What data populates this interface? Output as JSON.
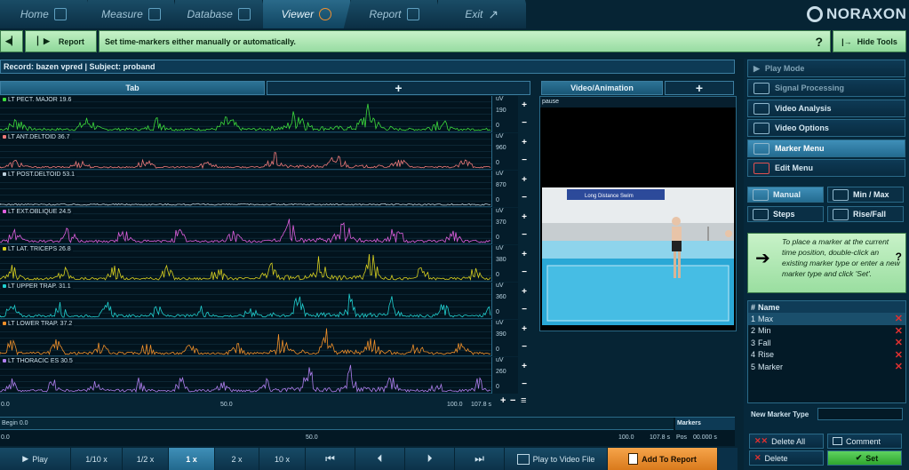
{
  "nav": {
    "tabs": [
      "Home",
      "Measure",
      "Database",
      "Viewer",
      "Report",
      "Exit"
    ],
    "active": "Viewer"
  },
  "brand": "NORAXON",
  "toolbar": {
    "report_label": "Report",
    "message": "Set time-markers either manually or automatically.",
    "help": "?",
    "hide_tools_label": "Hide Tools"
  },
  "record": {
    "text": "Record: bazen vpred | Subject: proband"
  },
  "emg_panel": {
    "tab_label": "Tab",
    "add_label": "+"
  },
  "video_panel": {
    "tab_label": "Video/Animation",
    "add_label": "+",
    "status": "pause",
    "banner_text": "Long Distance Swim"
  },
  "unit": "uV",
  "channels": [
    {
      "name": "LT PECT. MAJOR",
      "value": "19.6",
      "max": "190",
      "min": "0",
      "color": "#3ddc3d"
    },
    {
      "name": "LT ANT.DELTOID",
      "value": "36.7",
      "max": "960",
      "min": "0",
      "color": "#f07a7a"
    },
    {
      "name": "LT POST.DELTOID",
      "value": "53.1",
      "max": "870",
      "min": "0",
      "color": "#bcd0dc"
    },
    {
      "name": "LT EXT.OBLIQUE",
      "value": "24.5",
      "max": "370",
      "min": "0",
      "color": "#e060e0"
    },
    {
      "name": "LT LAT. TRICEPS",
      "value": "26.8",
      "max": "380",
      "min": "0",
      "color": "#d8d020"
    },
    {
      "name": "LT UPPER TRAP.",
      "value": "31.1",
      "max": "360",
      "min": "0",
      "color": "#20d0d0"
    },
    {
      "name": "LT LOWER TRAP.",
      "value": "37.2",
      "max": "390",
      "min": "0",
      "color": "#f0902a"
    },
    {
      "name": "LT THORACIC ES",
      "value": "30.5",
      "max": "260",
      "min": "0",
      "color": "#b080f0"
    }
  ],
  "emg_axis": {
    "start": "0.0",
    "mid": "50.0",
    "end": "100.0",
    "total": "107.8 s"
  },
  "timeline": {
    "begin_label": "Begin 0.0",
    "start": "0.0",
    "mid": "50.0",
    "end": "100.0",
    "total": "107.8 s",
    "markers_label": "Markers",
    "pos_label": "Pos",
    "pos_value": "00.000 s"
  },
  "controls": {
    "play": "Play",
    "speeds": [
      "1/10 x",
      "1/2 x",
      "1 x",
      "2 x",
      "10 x"
    ],
    "selected_speed": "1 x",
    "play_to_video": "Play to Video File",
    "add_to_report": "Add To Report"
  },
  "right_menu": [
    {
      "label": "Play Mode",
      "icon": "play-icon",
      "state": "dim"
    },
    {
      "label": "Signal Processing",
      "icon": "signal-processing-icon",
      "state": "dim"
    },
    {
      "label": "Video Analysis",
      "icon": "video-camera-icon",
      "state": "normal"
    },
    {
      "label": "Video Options",
      "icon": "video-camera-icon",
      "state": "normal"
    },
    {
      "label": "Marker Menu",
      "icon": "marker-menu-icon",
      "state": "active"
    },
    {
      "label": "Edit Menu",
      "icon": "edit-menu-icon",
      "state": "normal"
    }
  ],
  "marker_types": {
    "manual": "Manual",
    "minmax": "Min / Max",
    "steps": "Steps",
    "risefall": "Rise/Fall"
  },
  "hint": {
    "text": "To place a marker at the current time position, double-click an existing marker type or enter a new marker type and click 'Set'.",
    "help": "?"
  },
  "marker_list": {
    "col_num": "#",
    "col_name": "Name",
    "items": [
      {
        "num": "1",
        "name": "Max"
      },
      {
        "num": "2",
        "name": "Min"
      },
      {
        "num": "3",
        "name": "Fall"
      },
      {
        "num": "4",
        "name": "Rise"
      },
      {
        "num": "5",
        "name": "Marker"
      }
    ]
  },
  "new_marker": {
    "label": "New Marker Type",
    "value": ""
  },
  "actions": {
    "delete_all": "Delete All",
    "comment": "Comment",
    "delete": "Delete",
    "set": "Set"
  }
}
